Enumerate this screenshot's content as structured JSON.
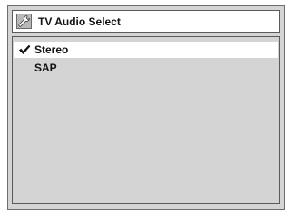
{
  "dialog": {
    "title": "TV Audio Select",
    "title_icon": "wrench-icon"
  },
  "menu": {
    "items": [
      {
        "label": "Stereo",
        "selected": true,
        "checked": true
      },
      {
        "label": "SAP",
        "selected": false,
        "checked": false
      }
    ]
  },
  "colors": {
    "panel_background": "#d4d4d4",
    "highlight_background": "#ffffff",
    "border": "#5a5a5a"
  }
}
